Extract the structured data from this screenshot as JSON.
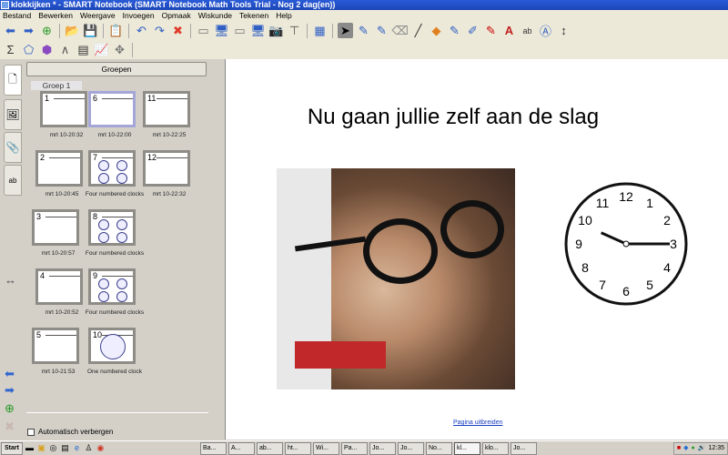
{
  "window": {
    "title": "klokkijken * - SMART Notebook (SMART Notebook Math Tools Trial - Nog 2 dag(en))"
  },
  "menu": [
    "Bestand",
    "Bewerken",
    "Weergave",
    "Invoegen",
    "Opmaak",
    "Wiskunde",
    "Tekenen",
    "Help"
  ],
  "sorter": {
    "groups_button": "Groepen",
    "group_label": "Groep 1",
    "autohide_label": "Automatisch verbergen",
    "thumbnails": [
      {
        "number": "1",
        "caption": "mrt 10-20:32"
      },
      {
        "number": "6",
        "caption": "mrt 10-22:00",
        "selected": true
      },
      {
        "number": "11",
        "caption": "mrt 10-22:25"
      },
      {
        "number": "2",
        "caption": "mrt 10-20:45"
      },
      {
        "number": "7",
        "caption": "Four numbered clocks"
      },
      {
        "number": "12",
        "caption": "mrt 10-22:32"
      },
      {
        "number": "3",
        "caption": "mrt 10-20:57"
      },
      {
        "number": "8",
        "caption": "Four numbered clocks"
      },
      {
        "number": "4",
        "caption": "mrt 10-20:52"
      },
      {
        "number": "9",
        "caption": "Four numbered clocks"
      },
      {
        "number": "5",
        "caption": "mrt 10-21:53"
      },
      {
        "number": "10",
        "caption": "One numbered clock"
      }
    ]
  },
  "slide": {
    "title": "Nu gaan jullie zelf aan de slag",
    "extend_link": "Pagina uitbreiden",
    "clock": {
      "numbers": [
        "12",
        "1",
        "2",
        "3",
        "4",
        "5",
        "6",
        "7",
        "8",
        "9",
        "10",
        "11"
      ],
      "hour": 9.8,
      "minute": 15
    }
  },
  "taskbar": {
    "start": "Start",
    "tasks": [
      "Ba...",
      "A...",
      "ab...",
      "ht...",
      "Wi...",
      "Pa...",
      "Jo...",
      "Jo...",
      "No...",
      "kl...",
      "klo...",
      "Jo..."
    ],
    "active_task": "kl...",
    "clock": "12:35"
  }
}
